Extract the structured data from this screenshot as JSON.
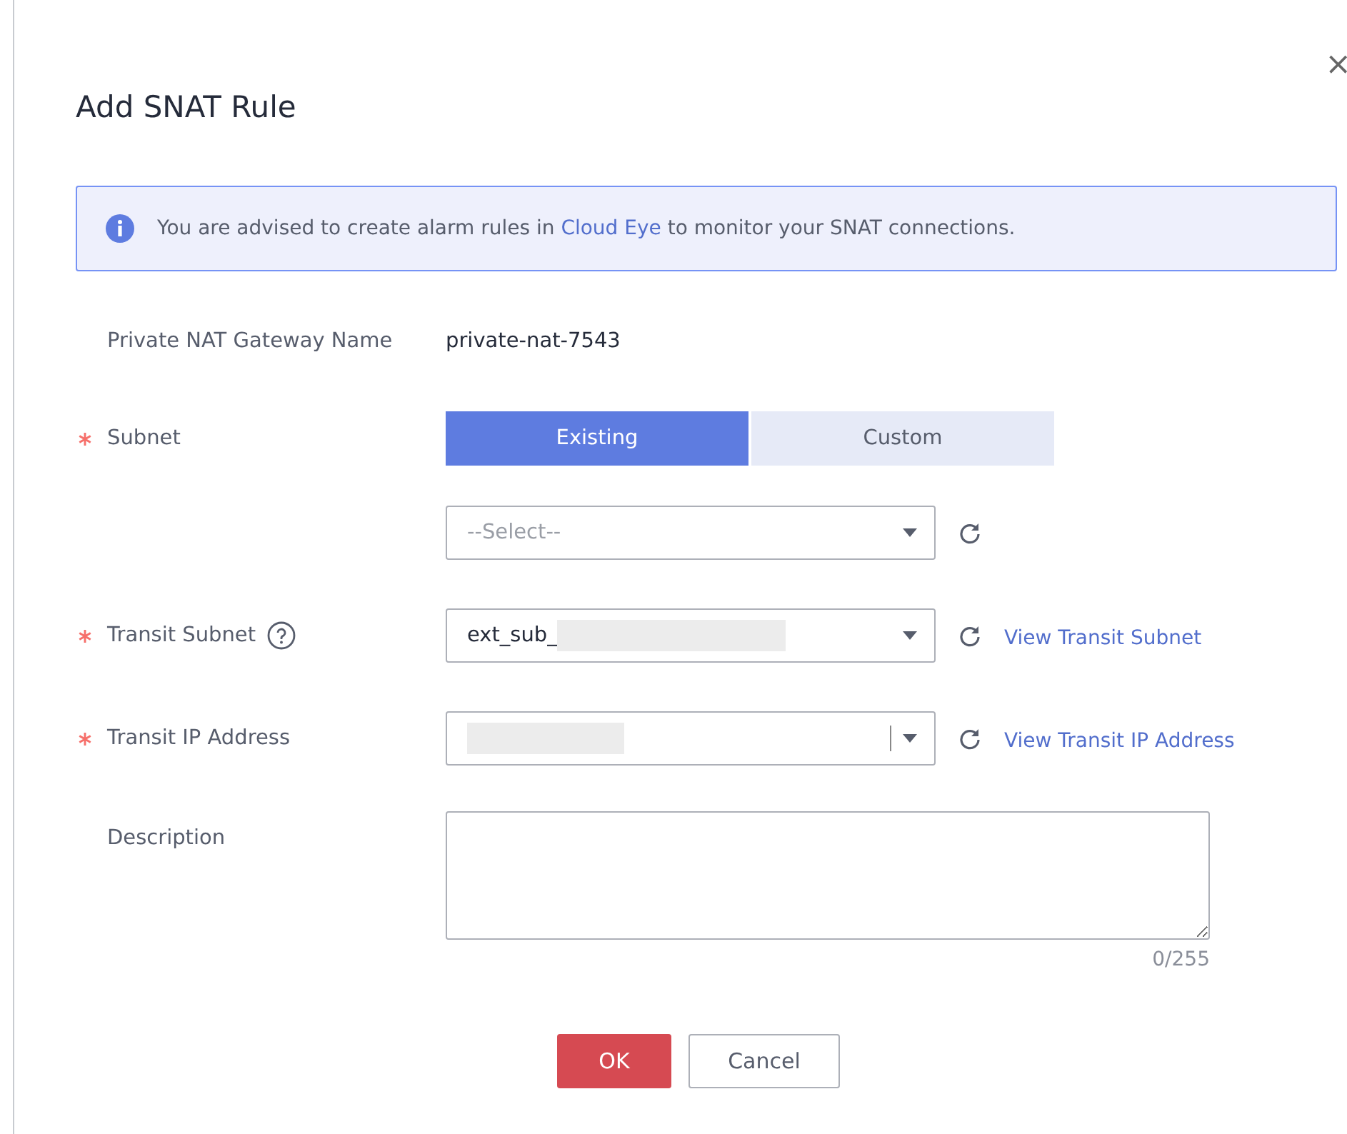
{
  "dialog": {
    "title": "Add SNAT Rule",
    "close": "×"
  },
  "notice": {
    "before": "You are advised to create alarm rules in ",
    "link": "Cloud Eye",
    "after": " to monitor your SNAT connections."
  },
  "gateway": {
    "label": "Private NAT Gateway Name",
    "value": "private-nat-7543"
  },
  "subnet": {
    "label": "Subnet",
    "required": true,
    "options": [
      {
        "label": "Existing",
        "selected": true
      },
      {
        "label": "Custom",
        "selected": false
      }
    ],
    "select": {
      "placeholder": "--Select--"
    }
  },
  "transit_subnet": {
    "label": "Transit Subnet",
    "required": true,
    "value": "ext_sub_",
    "redacted": true,
    "link": "View Transit Subnet"
  },
  "transit_ip": {
    "label": "Transit IP Address",
    "required": true,
    "redacted": true,
    "link": "View Transit IP Address"
  },
  "description": {
    "label": "Description",
    "count": "0/255"
  },
  "buttons": {
    "ok": "OK",
    "cancel": "Cancel"
  }
}
